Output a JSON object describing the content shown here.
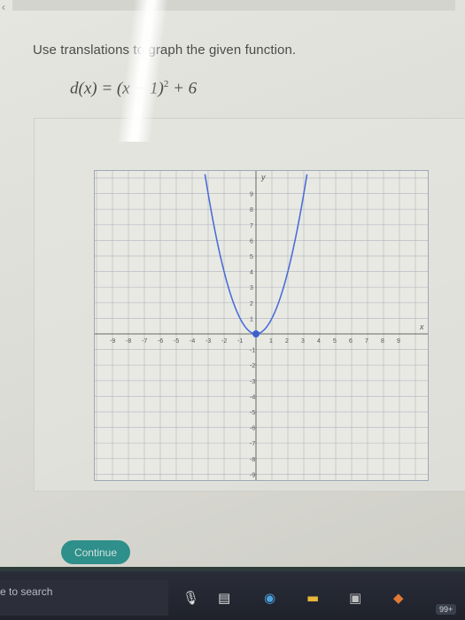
{
  "question": {
    "instruction": "Use translations to graph the given function.",
    "function_lhs": "d(x) = (x − 1)",
    "function_exp": "2",
    "function_rhs": " + 6"
  },
  "graph": {
    "x_axis_label": "x",
    "y_axis_label": "y",
    "x_ticks": [
      "-9",
      "-8",
      "-7",
      "-6",
      "-5",
      "-4",
      "-3",
      "-2",
      "-1",
      "1",
      "2",
      "3",
      "4",
      "5",
      "6",
      "7",
      "8",
      "9"
    ],
    "y_ticks_pos": [
      "9",
      "8",
      "7",
      "6",
      "5",
      "4",
      "3",
      "2",
      "1"
    ],
    "y_ticks_neg": [
      "-1",
      "-2",
      "-3",
      "-4",
      "-5",
      "-6",
      "-7",
      "-8",
      "-9"
    ],
    "curve_color": "#4a6fd6",
    "vertex_color": "#3f5fd0",
    "vertex": {
      "x": 0,
      "y": 0
    }
  },
  "buttons": {
    "continue_label": "Continue"
  },
  "taskbar": {
    "search_text": "e to search",
    "icons": [
      "microphone-icon",
      "task-view-icon",
      "edge-icon",
      "folder-icon",
      "store-icon",
      "office-icon"
    ],
    "badge": "99+"
  },
  "colors": {
    "button_bg": "#2f8f8a",
    "taskbar_bg": "#1f222b"
  }
}
